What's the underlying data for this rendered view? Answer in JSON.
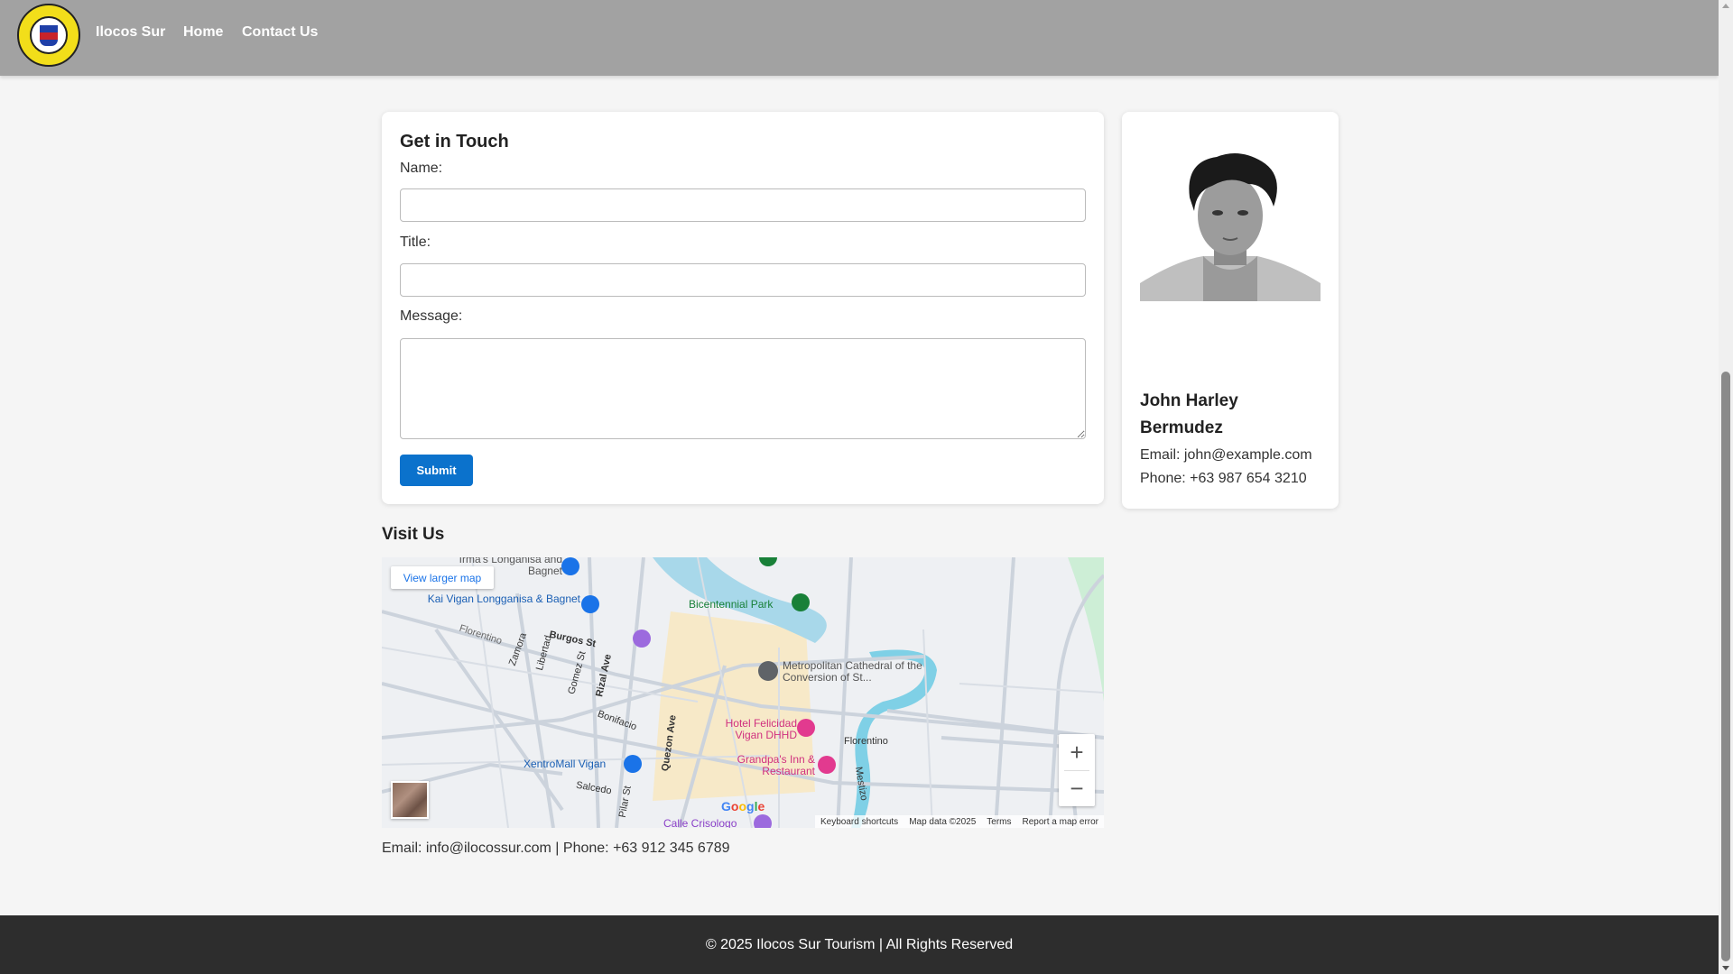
{
  "header": {
    "logo_text": "PROVINCE OF ILOCOS SUR · OFFICIAL SEAL",
    "nav": [
      "Ilocos Sur",
      "Home",
      "Contact Us"
    ]
  },
  "form": {
    "title": "Get in Touch",
    "name_label": "Name:",
    "title_label": "Title:",
    "message_label": "Message:",
    "submit_label": "Submit"
  },
  "profile": {
    "name": "John Harley Bermudez",
    "email": "Email: john@example.com",
    "phone": "Phone: +63 987 654 3210"
  },
  "visit": {
    "title": "Visit Us",
    "map": {
      "view_larger": "View larger map",
      "places": [
        "Irma's Longanisa and Bagnet",
        "Kai Vigan Longganisa & Bagnet",
        "Bicentennial Park",
        "Metropolitan Cathedral of the Conversion of St...",
        "Hotel Felicidad Vigan DHHD",
        "Grandpa's Inn & Restaurant",
        "XentroMall Vigan",
        "Calle Crisologo"
      ],
      "streets": [
        "Florentino",
        "Zamora",
        "Libertad",
        "Burgos St",
        "Gomez St",
        "Rizal Ave",
        "Bonifacio",
        "Quezon Ave",
        "Salcedo",
        "Pilar St",
        "Mestizo",
        "Florentino"
      ],
      "google": "Google",
      "footer_links": [
        "Keyboard shortcuts",
        "Map data ©2025",
        "Terms",
        "Report a map error"
      ],
      "zoom_in": "+",
      "zoom_out": "−"
    },
    "contact": "Email: info@ilocossur.com | Phone: +63 912 345 6789"
  },
  "footer": {
    "text": "© 2025 Ilocos Sur Tourism | All Rights Reserved"
  }
}
